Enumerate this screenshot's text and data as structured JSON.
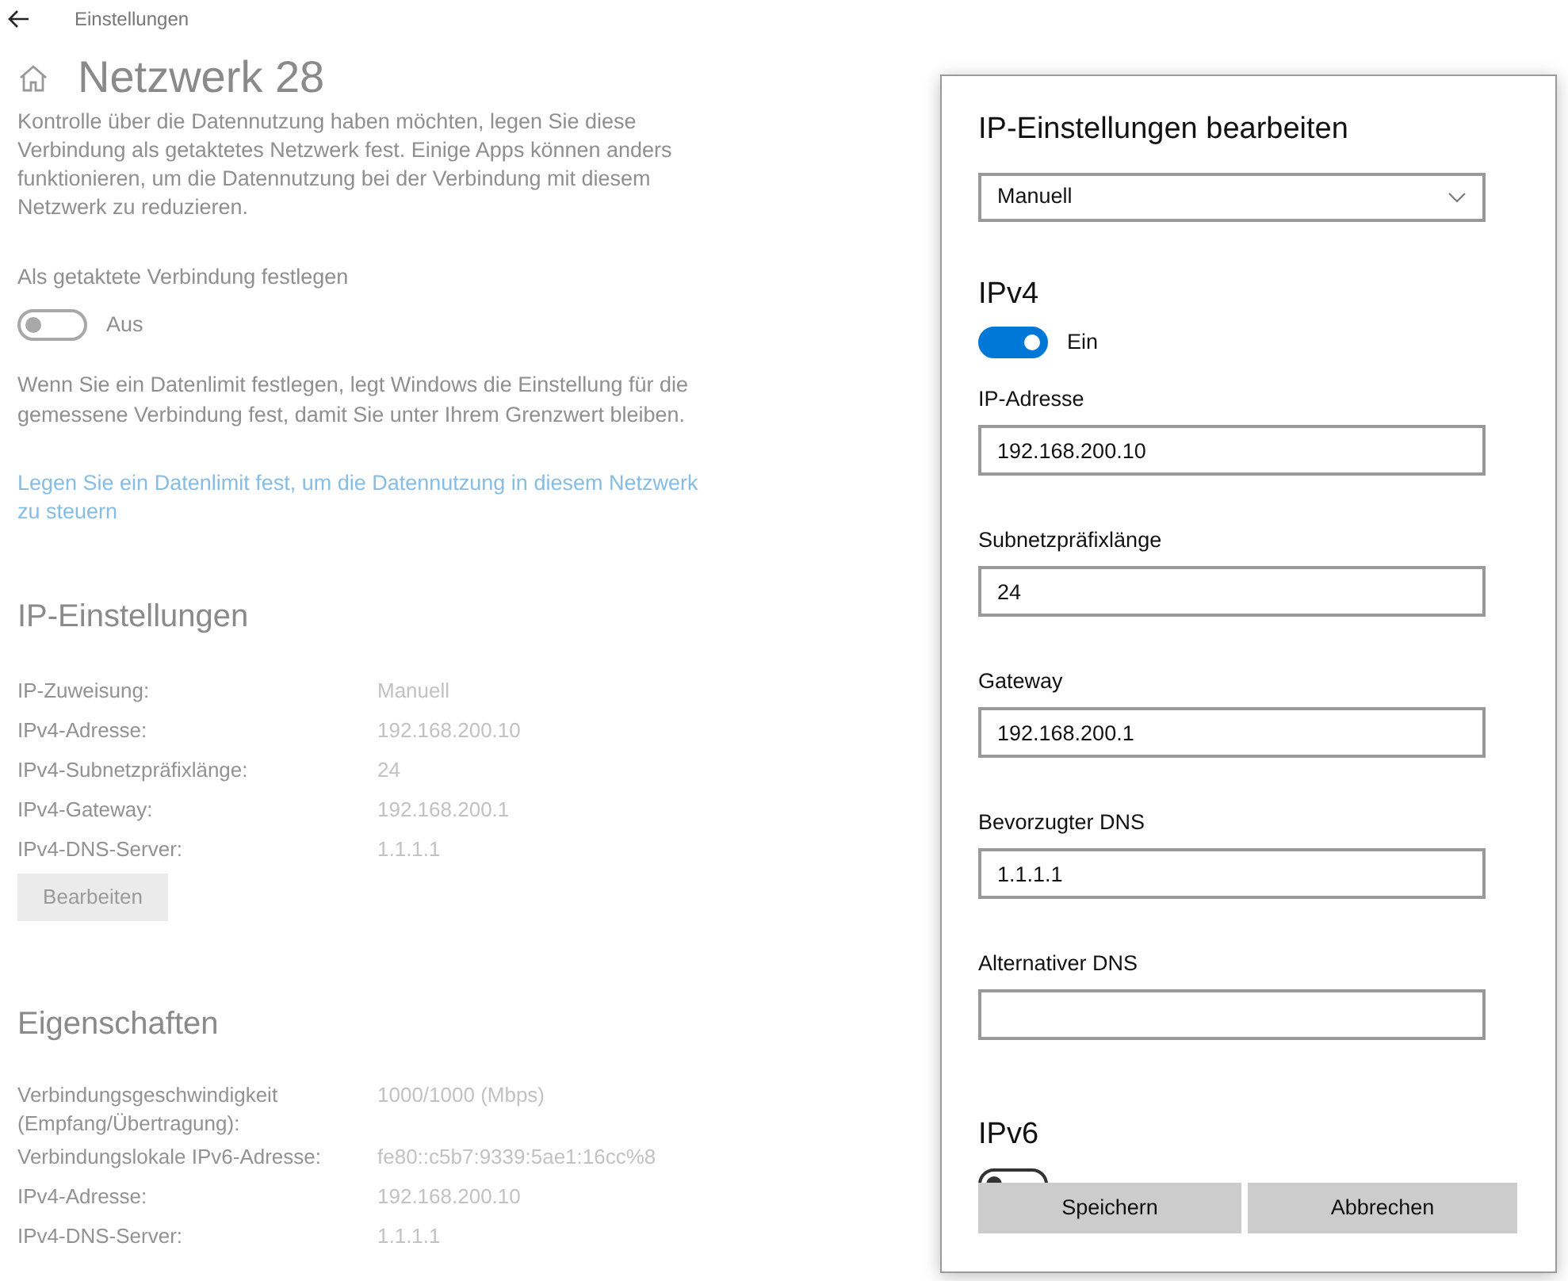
{
  "window": {
    "title": "Einstellungen"
  },
  "page": {
    "title": "Netzwerk 28",
    "intro": "Kontrolle über die Datennutzung haben möchten, legen Sie diese Verbindung als getaktetes Netzwerk fest. Einige Apps können anders funktionieren, um die Datennutzung bei der Verbindung mit diesem Netzwerk zu reduzieren.",
    "metered": {
      "label": "Als getaktete Verbindung festlegen",
      "on": false,
      "state_label": "Aus"
    },
    "limit_note": "Wenn Sie ein Datenlimit festlegen, legt Windows die Einstellung für die gemessene Verbindung fest, damit Sie unter Ihrem Grenzwert bleiben.",
    "limit_link": "Legen Sie ein Datenlimit fest, um die Datennutzung in diesem Netzwerk zu steuern",
    "ip_settings": {
      "title": "IP-Einstellungen",
      "rows": [
        {
          "label": "IP-Zuweisung:",
          "value": "Manuell"
        },
        {
          "label": "IPv4-Adresse:",
          "value": "192.168.200.10"
        },
        {
          "label": "IPv4-Subnetzpräfixlänge:",
          "value": "24"
        },
        {
          "label": "IPv4-Gateway:",
          "value": "192.168.200.1"
        },
        {
          "label": "IPv4-DNS-Server:",
          "value": "1.1.1.1"
        }
      ],
      "button": "Bearbeiten"
    },
    "properties": {
      "title": "Eigenschaften",
      "rows": [
        {
          "label": "Verbindungsgeschwindigkeit (Empfang/Übertragung):",
          "value": "1000/1000 (Mbps)"
        },
        {
          "label": "Verbindungslokale IPv6-Adresse:",
          "value": "fe80::c5b7:9339:5ae1:16cc%8"
        },
        {
          "label": "IPv4-Adresse:",
          "value": "192.168.200.10"
        },
        {
          "label": "IPv4-DNS-Server:",
          "value": "1.1.1.1"
        }
      ]
    }
  },
  "dialog": {
    "title": "IP-Einstellungen bearbeiten",
    "mode": "Manuell",
    "ipv4": {
      "title": "IPv4",
      "on": true,
      "state_label": "Ein",
      "fields": [
        {
          "label": "IP-Adresse",
          "value": "192.168.200.10"
        },
        {
          "label": "Subnetzpräfixlänge",
          "value": "24"
        },
        {
          "label": "Gateway",
          "value": "192.168.200.1"
        },
        {
          "label": "Bevorzugter DNS",
          "value": "1.1.1.1"
        },
        {
          "label": "Alternativer DNS"
        }
      ]
    },
    "ipv6": {
      "title": "IPv6",
      "on": false
    },
    "buttons": [
      "Speichern",
      "Abbrechen"
    ]
  }
}
